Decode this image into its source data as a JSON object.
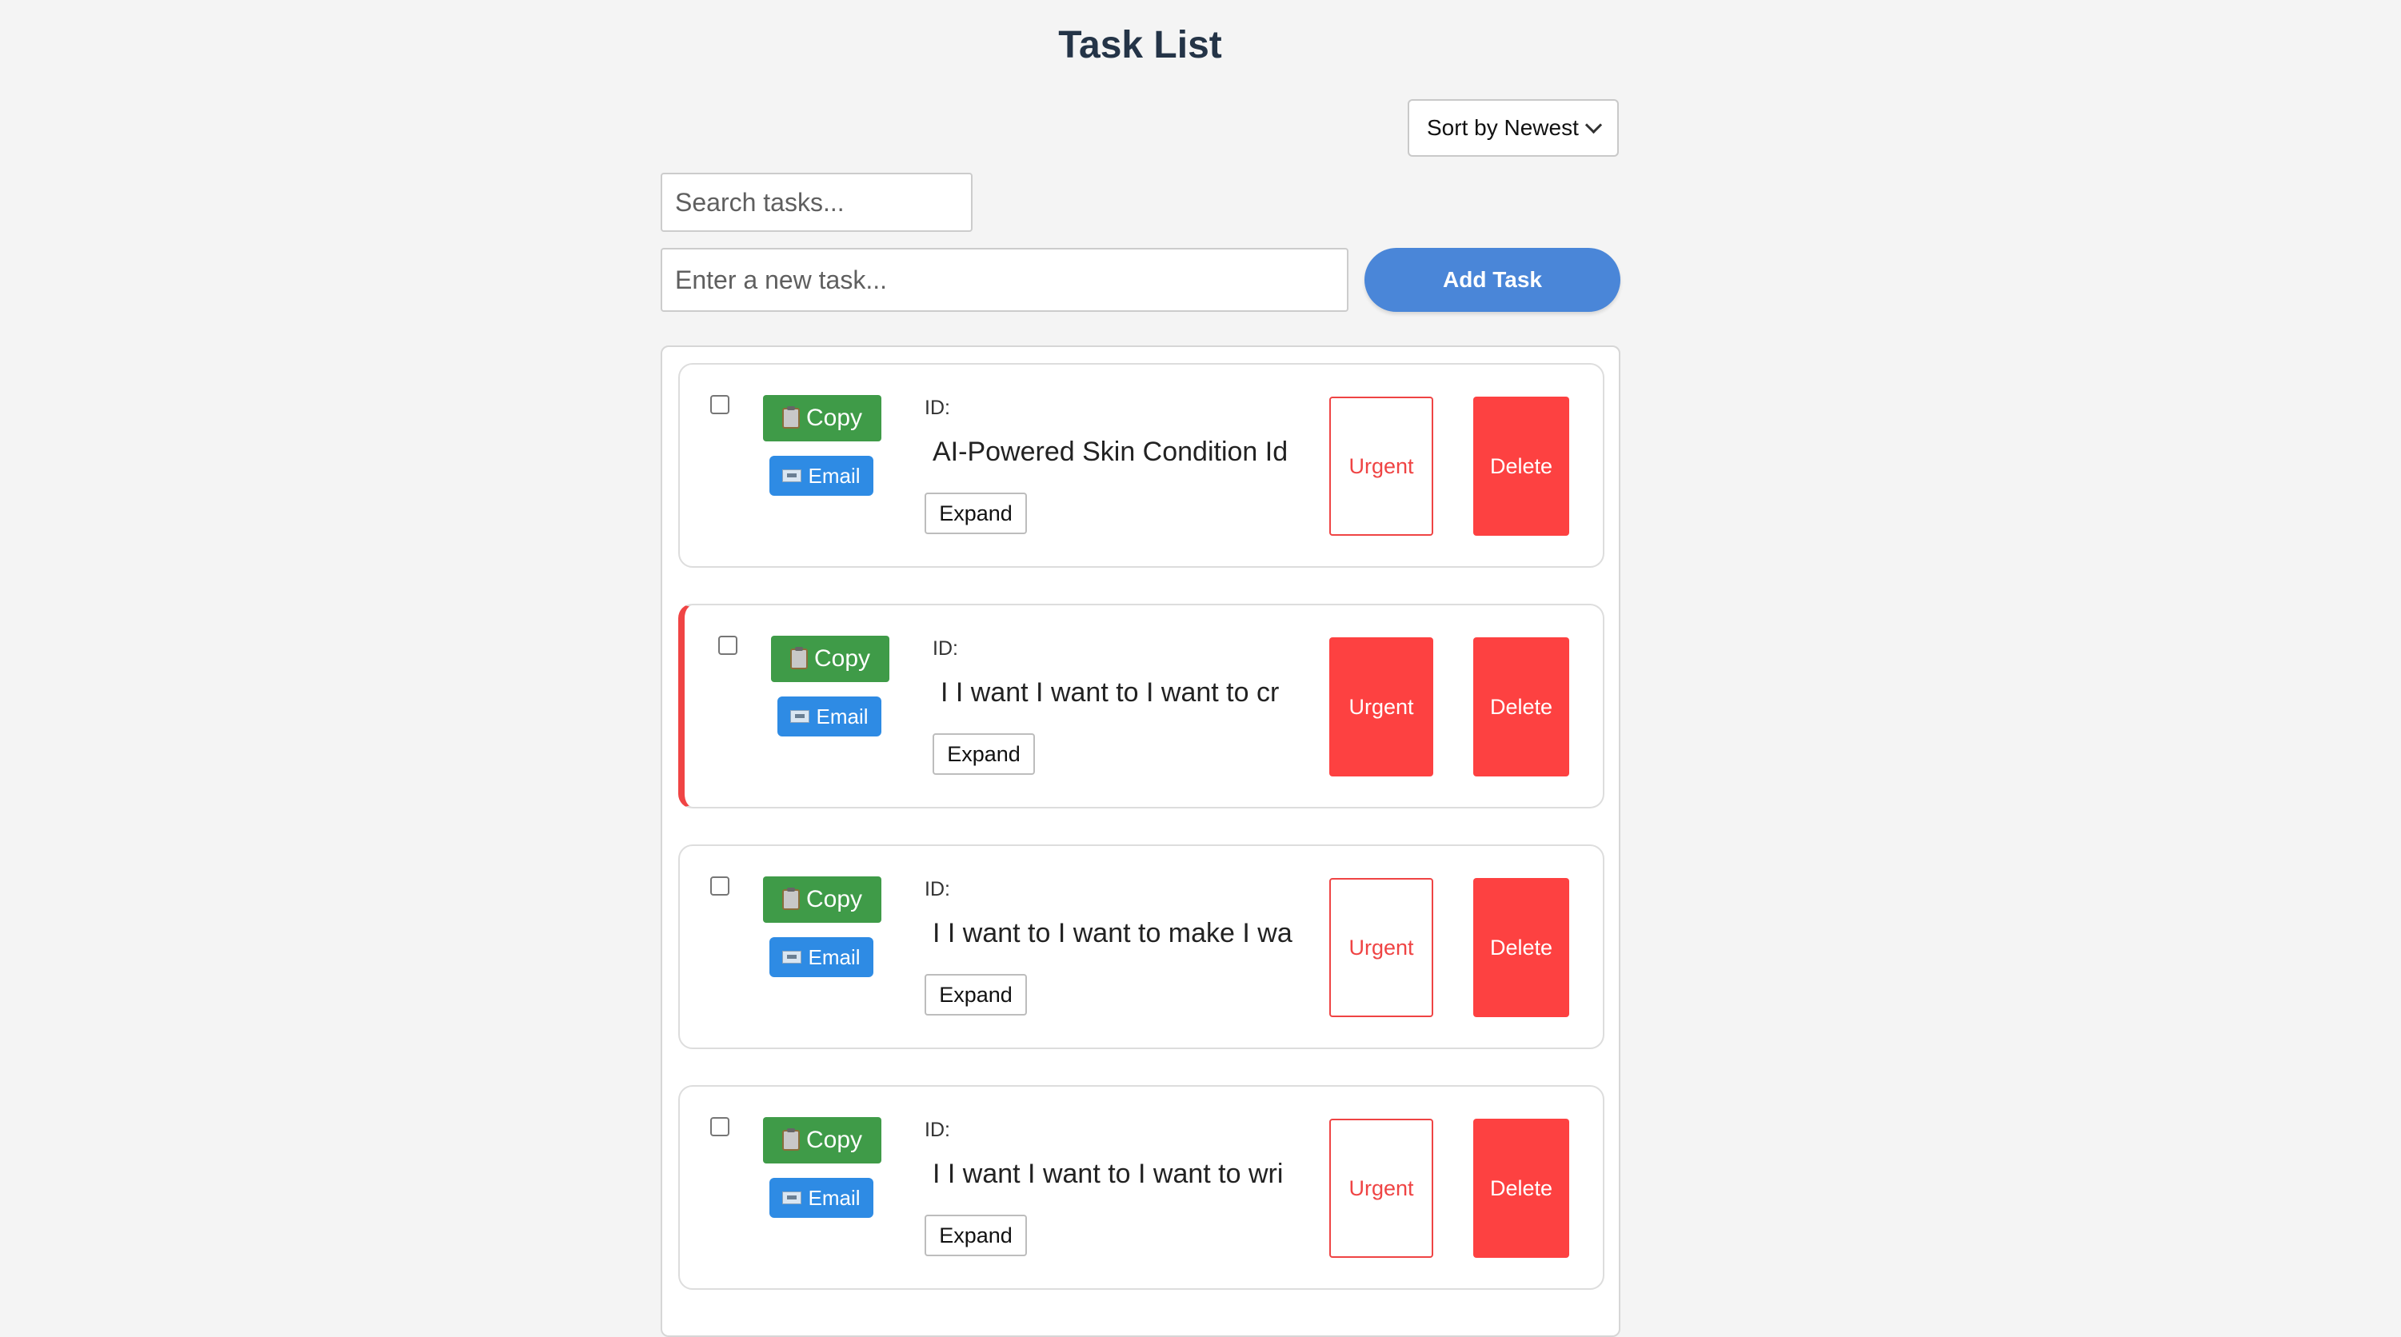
{
  "header": {
    "title": "Task List"
  },
  "sort": {
    "selected": "Sort by Newest"
  },
  "search": {
    "placeholder": "Search tasks..."
  },
  "new_task": {
    "placeholder": "Enter a new task...",
    "add_label": "Add Task"
  },
  "colors": {
    "add_button": "#4a86d8",
    "copy_button": "#3f9b48",
    "email_button": "#2e8be4",
    "urgent_red": "#fd4141",
    "title": "#243447"
  },
  "tasks": [
    {
      "checked": false,
      "copy_label": "Copy",
      "email_label": "Email",
      "id_label": "ID:",
      "text": "AI-Powered Skin Condition Id",
      "expand_label": "Expand",
      "urgent_label": "Urgent",
      "urgent": false,
      "delete_label": "Delete"
    },
    {
      "checked": false,
      "copy_label": "Copy",
      "email_label": "Email",
      "id_label": "ID:",
      "text": "I I want I want to I want to cr",
      "expand_label": "Expand",
      "urgent_label": "Urgent",
      "urgent": true,
      "delete_label": "Delete"
    },
    {
      "checked": false,
      "copy_label": "Copy",
      "email_label": "Email",
      "id_label": "ID:",
      "text": "I I want to I want to make I wa",
      "expand_label": "Expand",
      "urgent_label": "Urgent",
      "urgent": false,
      "delete_label": "Delete"
    },
    {
      "checked": false,
      "copy_label": "Copy",
      "email_label": "Email",
      "id_label": "ID:",
      "text": "I I want I want to I want to wri",
      "expand_label": "Expand",
      "urgent_label": "Urgent",
      "urgent": false,
      "delete_label": "Delete"
    }
  ]
}
